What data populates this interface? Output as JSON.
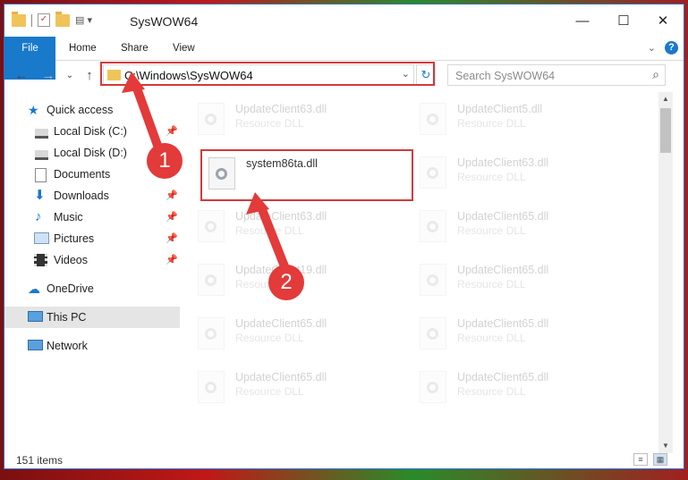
{
  "window": {
    "title": "SysWOW64",
    "close": "✕",
    "maximize": "☐",
    "minimize": "—"
  },
  "ribbon": {
    "tabs": [
      "File",
      "Home",
      "Share",
      "View"
    ]
  },
  "address": {
    "path": "C:\\Windows\\SysWOW64",
    "search_placeholder": "Search SysWOW64"
  },
  "nav": {
    "items": [
      {
        "label": "Quick access",
        "icon": "star-icon"
      },
      {
        "label": "Local Disk (C:)",
        "icon": "drive-icon",
        "pinned": true
      },
      {
        "label": "Local Disk (D:)",
        "icon": "drive-icon"
      },
      {
        "label": "Documents",
        "icon": "documents-icon"
      },
      {
        "label": "Downloads",
        "icon": "download-icon",
        "pinned": true
      },
      {
        "label": "Music",
        "icon": "music-icon",
        "pinned": true
      },
      {
        "label": "Pictures",
        "icon": "pictures-icon",
        "pinned": true
      },
      {
        "label": "Videos",
        "icon": "videos-icon",
        "pinned": true
      },
      {
        "label": "OneDrive",
        "icon": "cloud-icon"
      },
      {
        "label": "This PC",
        "icon": "pc-icon",
        "selected": true
      },
      {
        "label": "Network",
        "icon": "network-icon"
      }
    ]
  },
  "files": [
    {
      "name": "UpdateClient63.dll",
      "type": "Resource DLL"
    },
    {
      "name": "UpdateClient5.dll",
      "type": "Resource DLL"
    },
    {
      "name": "system86ta.dll",
      "type": ""
    },
    {
      "name": "UpdateClient63.dll",
      "type": "Resource DLL"
    },
    {
      "name": "UpdateClient63.dll",
      "type": "Resource DLL"
    },
    {
      "name": "UpdateClient65.dll",
      "type": "Resource DLL"
    },
    {
      "name": "UpdateClient19.dll",
      "type": "Resource DLL"
    },
    {
      "name": "UpdateClient65.dll",
      "type": "Resource DLL"
    },
    {
      "name": "UpdateClient65.dll",
      "type": "Resource DLL"
    },
    {
      "name": "UpdateClient65.dll",
      "type": "Resource DLL"
    },
    {
      "name": "UpdateClient65.dll",
      "type": "Resource DLL"
    },
    {
      "name": "UpdateClient65.dll",
      "type": "Resource DLL"
    }
  ],
  "status": {
    "count": "151 items"
  },
  "annotations": {
    "step1": "1",
    "step2": "2",
    "accent": "#e33a3a"
  }
}
